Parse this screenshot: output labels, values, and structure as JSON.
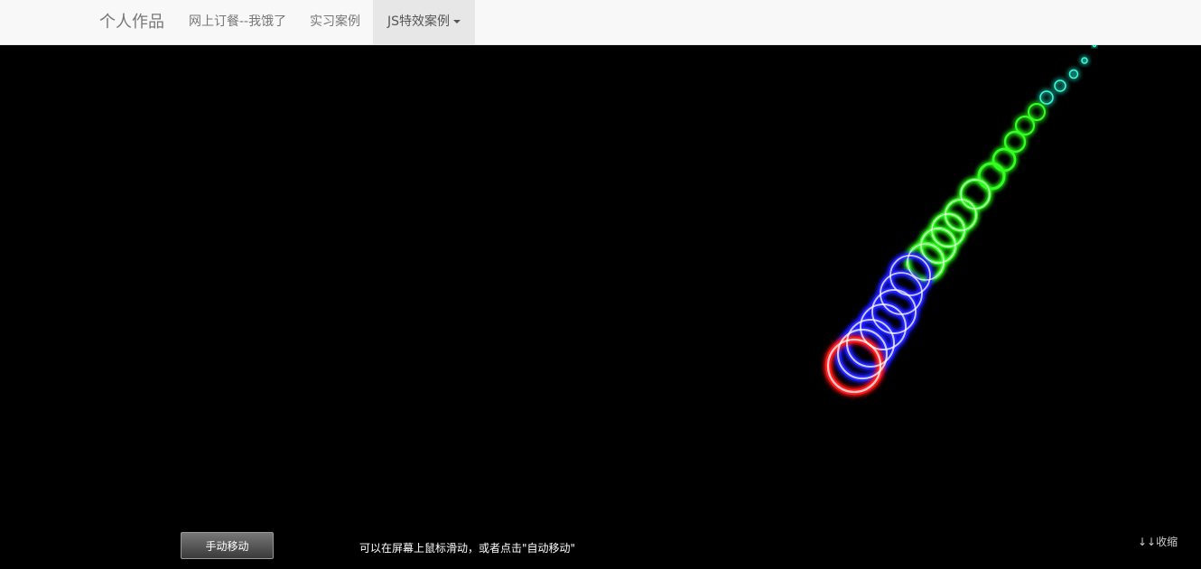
{
  "navbar": {
    "brand": "个人作品",
    "links": [
      {
        "label": "网上订餐--我饿了"
      },
      {
        "label": "实习案例"
      },
      {
        "label": "JS特效案例",
        "active": true,
        "dropdown": true
      }
    ]
  },
  "stage": {
    "background_color": "#000000",
    "ring_colors": {
      "red": "#ff1a1a",
      "blue": "#2222ff",
      "green": "#33ff22",
      "cyan": "#33ffdd"
    }
  },
  "footer": {
    "manual_button_label": "手动移动",
    "hint_text": "可以在屏幕上鼠标滑动，或者点击\"自动移动\"",
    "collapse_label": "↓↓收缩"
  }
}
